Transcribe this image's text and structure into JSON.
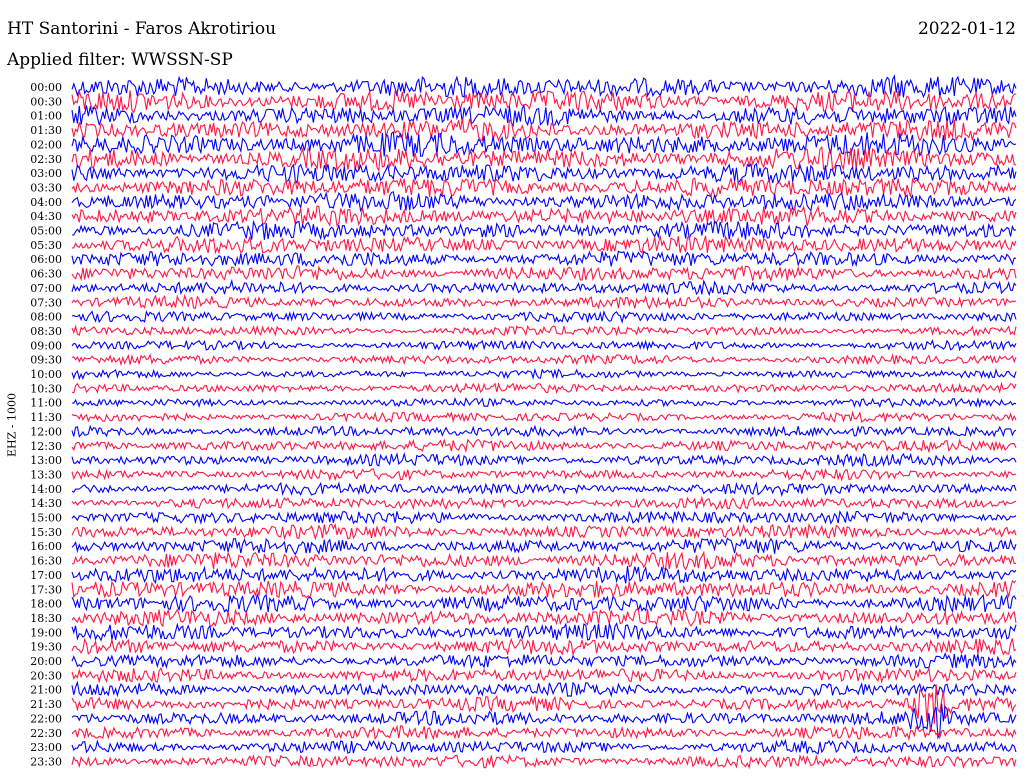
{
  "header": {
    "station": "HT Santorini - Faros Akrotiriou",
    "date": "2022-01-12",
    "filter": "Applied filter: WWSSN-SP"
  },
  "channel_label": "EHZ - 1000",
  "colors": {
    "trace_a": "#0000ff",
    "trace_b": "#ff1744",
    "background": "#ffffff"
  },
  "chart_data": {
    "type": "line",
    "subtype": "helicorder",
    "grid": false,
    "ylabel": "EHZ - 1000",
    "row_labels": [
      "00:00",
      "00:30",
      "01:00",
      "01:30",
      "02:00",
      "02:30",
      "03:00",
      "03:30",
      "04:00",
      "04:30",
      "05:00",
      "05:30",
      "06:00",
      "06:30",
      "07:00",
      "07:30",
      "08:00",
      "08:30",
      "09:00",
      "09:30",
      "10:00",
      "10:30",
      "11:00",
      "11:30",
      "12:00",
      "12:30",
      "13:00",
      "13:30",
      "14:00",
      "14:30",
      "15:00",
      "15:30",
      "16:00",
      "16:30",
      "17:00",
      "17:30",
      "18:00",
      "18:30",
      "19:00",
      "19:30",
      "20:00",
      "20:30",
      "21:00",
      "21:30",
      "22:00",
      "22:30",
      "23:00",
      "23:30"
    ],
    "series": [
      {
        "color": "#0000ff"
      },
      {
        "color": "#ff1744"
      }
    ],
    "relative_amplitude": [
      0.9,
      0.95,
      0.85,
      0.9,
      1.0,
      0.95,
      0.85,
      0.85,
      0.8,
      0.8,
      0.75,
      0.75,
      0.7,
      0.65,
      0.55,
      0.5,
      0.45,
      0.4,
      0.4,
      0.4,
      0.35,
      0.4,
      0.35,
      0.4,
      0.45,
      0.5,
      0.5,
      0.45,
      0.5,
      0.5,
      0.55,
      0.6,
      0.65,
      0.7,
      0.7,
      0.75,
      0.75,
      0.7,
      0.7,
      0.65,
      0.6,
      0.6,
      0.6,
      0.6,
      0.6,
      0.55,
      0.55,
      0.55
    ],
    "events": [
      {
        "row_label": "21:30",
        "x_fraction": 0.91,
        "peak_relative_amplitude": 2.2
      },
      {
        "row_label": "22:00",
        "x_fraction": 0.905,
        "peak_relative_amplitude": 2.6
      }
    ]
  }
}
